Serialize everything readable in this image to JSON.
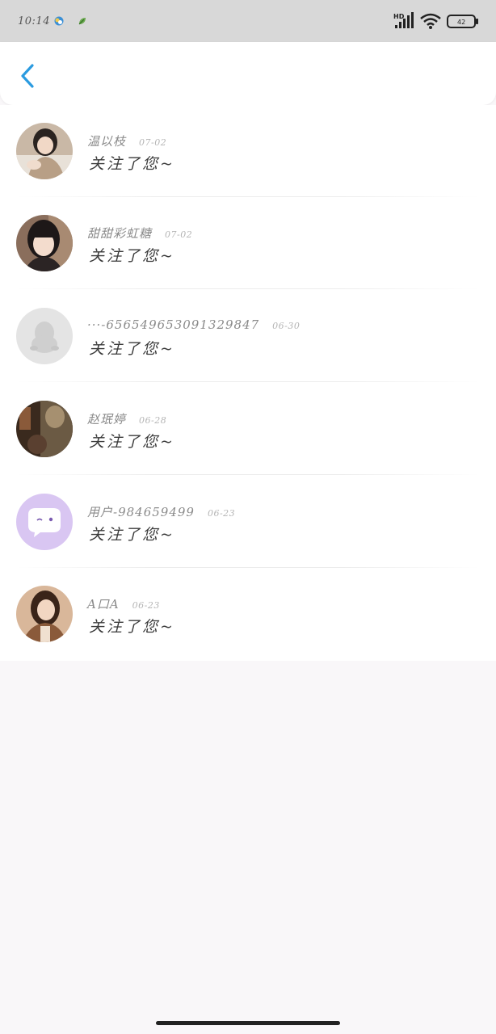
{
  "status_bar": {
    "time": "10:14",
    "battery": "42",
    "signal_label": "HD",
    "icons": [
      "weather-icon",
      "leaf-icon",
      "hd-signal-icon",
      "wifi-icon",
      "battery-icon"
    ]
  },
  "header": {
    "back_icon": "chevron-left-icon",
    "accent_color": "#2b9be0"
  },
  "followers": [
    {
      "name": "温以枝",
      "date": "07-02",
      "message": "关注了您~",
      "avatar": "photo"
    },
    {
      "name": "甜甜彩虹糖",
      "date": "07-02",
      "message": "关注了您~",
      "avatar": "photo"
    },
    {
      "name": "···-656549653091329847",
      "date": "06-30",
      "message": "关注了您~",
      "avatar": "default-penguin"
    },
    {
      "name": "赵珉婷",
      "date": "06-28",
      "message": "关注了您~",
      "avatar": "photo"
    },
    {
      "name": "用户-984659499",
      "date": "06-23",
      "message": "关注了您~",
      "avatar": "chat-bubble"
    },
    {
      "name": "A口A",
      "date": "06-23",
      "message": "关注了您~",
      "avatar": "photo"
    }
  ]
}
